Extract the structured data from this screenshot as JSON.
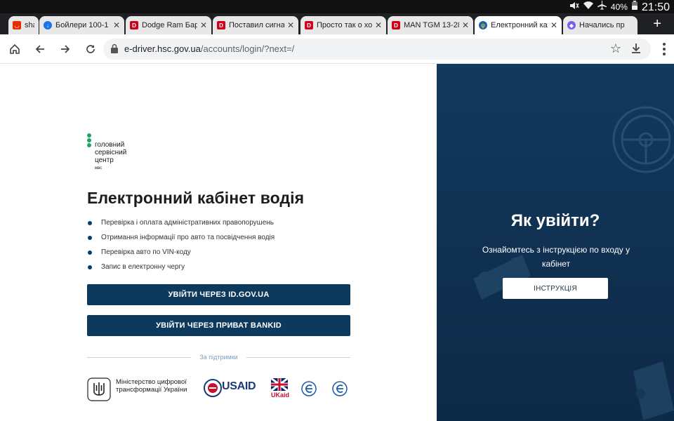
{
  "status_bar": {
    "battery": "40%",
    "time": "21:50",
    "icons": [
      "mute-icon",
      "wifi-icon",
      "airplane-icon",
      "battery-icon"
    ]
  },
  "tabs": [
    {
      "label": "sha",
      "favicon": "aliexpress-icon",
      "favicon_color": "#e62e04",
      "active": false
    },
    {
      "label": "Бойлери 100-1",
      "favicon": "globe-icon",
      "favicon_color": "#1a73e8",
      "active": false
    },
    {
      "label": "Dodge Ram Бар",
      "favicon": "drive2-icon",
      "favicon_color": "#d0021b",
      "active": false
    },
    {
      "label": "Поставил сигна",
      "favicon": "drive2-icon",
      "favicon_color": "#d0021b",
      "active": false
    },
    {
      "label": "Просто так о хо",
      "favicon": "drive2-icon",
      "favicon_color": "#d0021b",
      "active": false
    },
    {
      "label": "MAN TGM 13-28",
      "favicon": "drive2-icon",
      "favicon_color": "#d0021b",
      "active": false
    },
    {
      "label": "Електронний ка",
      "favicon": "ukraine-emblem-icon",
      "favicon_color": "#1a5fb4",
      "active": true
    },
    {
      "label": "Начались пр",
      "favicon": "viber-icon",
      "favicon_color": "#7360f2",
      "active": false
    }
  ],
  "new_tab_label": "+",
  "toolbar": {
    "url_host": "e-driver.hsc.gov.ua",
    "url_path": "/accounts/login/?next=/"
  },
  "page": {
    "logo": {
      "line1": "головний",
      "line2": "сервісний",
      "line3": "центр",
      "sub": "мвс"
    },
    "title": "Електронний кабінет водія",
    "features": [
      "Перевірка і оплата адміністративних правопорушень",
      "Отримання інформації про авто та посвідчення водія",
      "Перевірка авто по VIN-коду",
      "Запис в електронну чергу"
    ],
    "login_id_gov": "УВІЙТИ ЧЕРЕЗ ID.GOV.UA",
    "login_privat": "УВІЙТИ ЧЕРЕЗ ПРИВАТ BANKID",
    "support_label": "За підтримки",
    "partners": {
      "ministry": "Міністерство цифрової трансформації України",
      "usaid": "USAID",
      "ukaid": "UKaid"
    },
    "right": {
      "title": "Як увійти?",
      "desc": "Ознайомтесь з інструкцією по входу у кабінет",
      "button": "ІНСТРУКЦІЯ"
    }
  },
  "colors": {
    "primary_button": "#0d3a5c",
    "right_panel": "#123a5e",
    "logo_green": "#1aa866"
  }
}
